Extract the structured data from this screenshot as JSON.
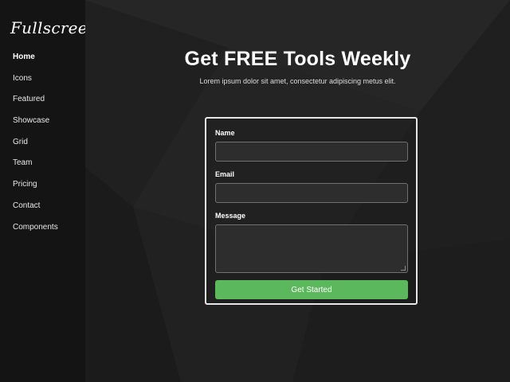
{
  "brand": {
    "logo": "Fullscreen"
  },
  "sidebar": {
    "items": [
      {
        "label": "Home",
        "active": true
      },
      {
        "label": "Icons",
        "active": false
      },
      {
        "label": "Featured",
        "active": false
      },
      {
        "label": "Showcase",
        "active": false
      },
      {
        "label": "Grid",
        "active": false
      },
      {
        "label": "Team",
        "active": false
      },
      {
        "label": "Pricing",
        "active": false
      },
      {
        "label": "Contact",
        "active": false
      },
      {
        "label": "Components",
        "active": false
      }
    ]
  },
  "hero": {
    "title": "Get FREE Tools Weekly",
    "subtitle": "Lorem ipsum dolor sit amet, consectetur adipiscing metus elit."
  },
  "form": {
    "name_label": "Name",
    "name_value": "",
    "email_label": "Email",
    "email_value": "",
    "message_label": "Message",
    "message_value": "",
    "submit_label": "Get Started"
  },
  "colors": {
    "sidebar_bg": "#141414",
    "main_bg": "#232323",
    "button": "#5cb85c"
  }
}
